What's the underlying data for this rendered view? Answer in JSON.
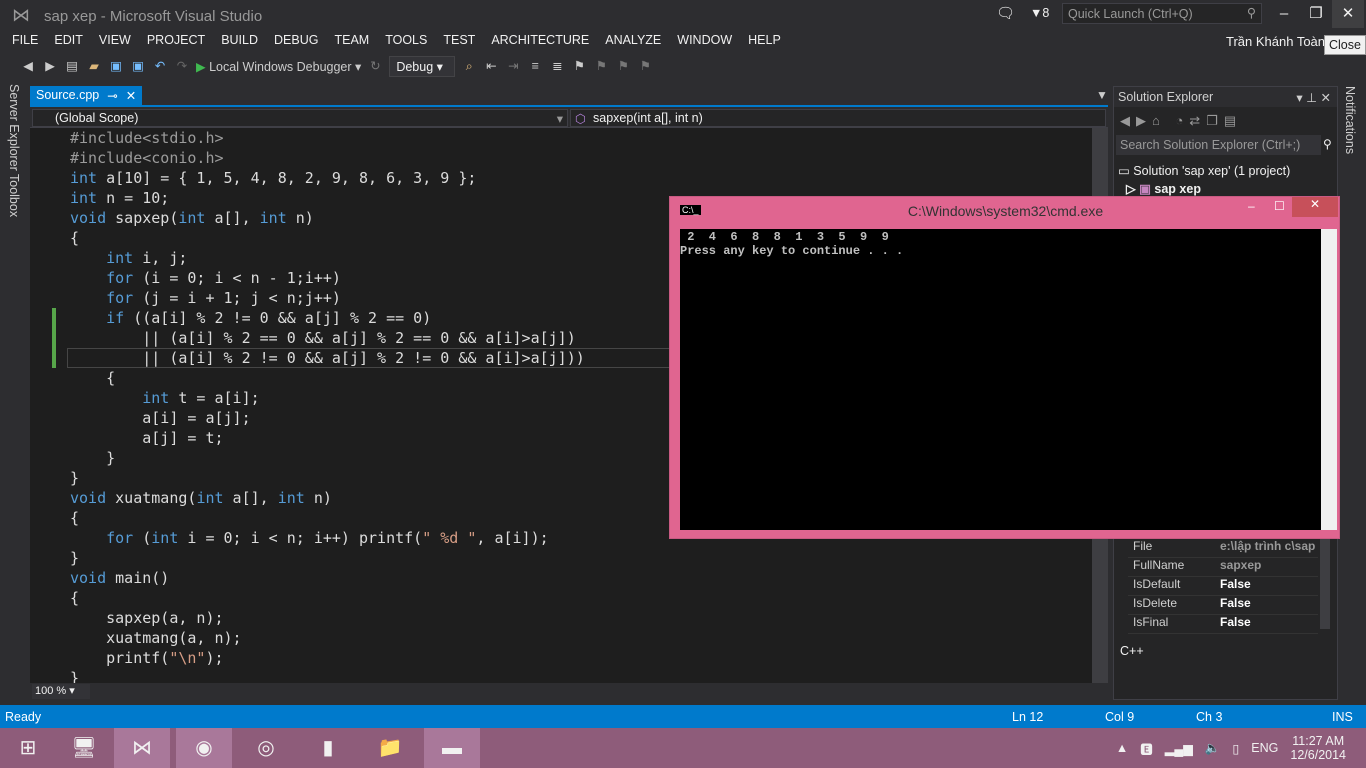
{
  "window": {
    "title": "sap xep - Microsoft Visual Studio",
    "notifications_count": "8",
    "quick_launch_placeholder": "Quick Launch (Ctrl+Q)",
    "user": "Trần Khánh Toàn",
    "close_tooltip": "Close"
  },
  "menu": [
    "FILE",
    "EDIT",
    "VIEW",
    "PROJECT",
    "BUILD",
    "DEBUG",
    "TEAM",
    "TOOLS",
    "TEST",
    "ARCHITECTURE",
    "ANALYZE",
    "WINDOW",
    "HELP"
  ],
  "toolbar": {
    "debugger_label": "Local Windows Debugger",
    "config": "Debug"
  },
  "left_tabs": [
    "Server Explorer",
    "Toolbox"
  ],
  "editor": {
    "tab": "Source.cpp",
    "scope": "(Global Scope)",
    "member": "sapxep(int a[], int n)",
    "zoom": "100 %",
    "lines": [
      [
        [
          "pp",
          "#include<stdio.h>"
        ]
      ],
      [
        [
          "pp",
          "#include<conio.h>"
        ]
      ],
      [
        [
          "kw",
          "int"
        ],
        [
          "t",
          " a[10] = { 1, 5, 4, 8, 2, 9, 8, 6, 3, 9 };"
        ]
      ],
      [
        [
          "kw",
          "int"
        ],
        [
          "t",
          " n = 10;"
        ]
      ],
      [
        [
          "kw",
          "void"
        ],
        [
          "t",
          " sapxep("
        ],
        [
          "kw",
          "int"
        ],
        [
          "t",
          " a[], "
        ],
        [
          "kw",
          "int"
        ],
        [
          "t",
          " n)"
        ]
      ],
      [
        [
          "t",
          "{"
        ]
      ],
      [
        [
          "t",
          "    "
        ],
        [
          "kw",
          "int"
        ],
        [
          "t",
          " i, j;"
        ]
      ],
      [
        [
          "t",
          "    "
        ],
        [
          "kw",
          "for"
        ],
        [
          "t",
          " (i = 0; i < n - 1;i++)"
        ]
      ],
      [
        [
          "t",
          "    "
        ],
        [
          "kw",
          "for"
        ],
        [
          "t",
          " (j = i + 1; j < n;j++)"
        ]
      ],
      [
        [
          "t",
          "    "
        ],
        [
          "kw",
          "if"
        ],
        [
          "t",
          " ((a[i] % 2 != 0 && a[j] % 2 == 0)"
        ]
      ],
      [
        [
          "t",
          "        || (a[i] % 2 == 0 && a[j] % 2 == 0 && a[i]>a[j])"
        ]
      ],
      [
        [
          "t",
          "        || (a[i] % 2 != 0 && a[j] % 2 != 0 && a[i]>a[j]))"
        ]
      ],
      [
        [
          "t",
          "    {"
        ]
      ],
      [
        [
          "t",
          "        "
        ],
        [
          "kw",
          "int"
        ],
        [
          "t",
          " t = a[i];"
        ]
      ],
      [
        [
          "t",
          "        a[i] = a[j];"
        ]
      ],
      [
        [
          "t",
          "        a[j] = t;"
        ]
      ],
      [
        [
          "t",
          "    }"
        ]
      ],
      [
        [
          "t",
          "}"
        ]
      ],
      [
        [
          "kw",
          "void"
        ],
        [
          "t",
          " xuatmang("
        ],
        [
          "kw",
          "int"
        ],
        [
          "t",
          " a[], "
        ],
        [
          "kw",
          "int"
        ],
        [
          "t",
          " n)"
        ]
      ],
      [
        [
          "t",
          "{"
        ]
      ],
      [
        [
          "t",
          "    "
        ],
        [
          "kw",
          "for"
        ],
        [
          "t",
          " ("
        ],
        [
          "kw",
          "int"
        ],
        [
          "t",
          " i = 0; i < n; i++) printf("
        ],
        [
          "str",
          "\" %d \""
        ],
        [
          "t",
          ", a[i]);"
        ]
      ],
      [
        [
          "t",
          "}"
        ]
      ],
      [
        [
          "kw",
          "void"
        ],
        [
          "t",
          " main()"
        ]
      ],
      [
        [
          "t",
          "{"
        ]
      ],
      [
        [
          "t",
          "    sapxep(a, n);"
        ]
      ],
      [
        [
          "t",
          "    xuatmang(a, n);"
        ]
      ],
      [
        [
          "t",
          "    printf("
        ],
        [
          "str",
          "\"\\n\""
        ],
        [
          "t",
          ");"
        ]
      ],
      [
        [
          "t",
          "}"
        ]
      ]
    ]
  },
  "solution_explorer": {
    "title": "Solution Explorer",
    "search_placeholder": "Search Solution Explorer (Ctrl+;)",
    "solution": "Solution 'sap xep' (1 project)",
    "project": "sap xep",
    "properties": [
      [
        "File",
        "e:\\lập trình c\\sap"
      ],
      [
        "FullName",
        "sapxep"
      ],
      [
        "IsDefault",
        "False"
      ],
      [
        "IsDelete",
        "False"
      ],
      [
        "IsFinal",
        "False"
      ]
    ],
    "description": "C++"
  },
  "notifications_label": "Notifications",
  "cmd": {
    "title": "C:\\Windows\\system32\\cmd.exe",
    "output": " 2  4  6  8  8  1  3  5  9  9\nPress any key to continue . . ."
  },
  "status": {
    "state": "Ready",
    "line": "Ln 12",
    "col": "Col 9",
    "ch": "Ch 3",
    "mode": "INS"
  },
  "taskbar": {
    "lang": "ENG",
    "time": "11:27 AM",
    "date": "12/6/2014"
  },
  "colors": {
    "accent": "#007acc",
    "cmd_frame": "#e06590",
    "keyword": "#569cd6",
    "string": "#d69d85"
  }
}
